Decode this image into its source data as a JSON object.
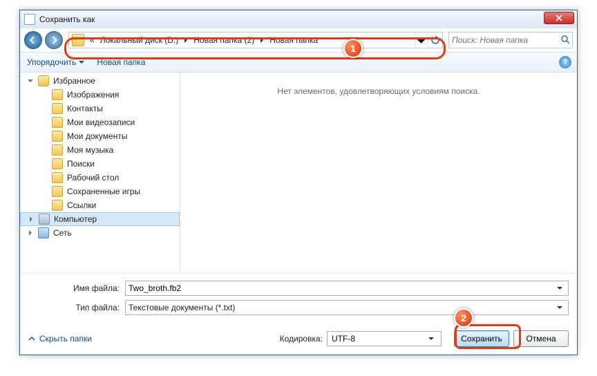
{
  "window": {
    "title": "Сохранить как"
  },
  "nav": {
    "breadcrumbs": [
      "Локальный диск (D:)",
      "Новая папка (2)",
      "Новая папка"
    ],
    "overflow": "«",
    "search_placeholder": "Поиск: Новая папка"
  },
  "toolbar": {
    "organize": "Упорядочить",
    "newfolder": "Новая папка"
  },
  "tree": {
    "items": [
      {
        "label": "Избранное",
        "kind": "star",
        "cat": true,
        "exp": "down"
      },
      {
        "label": "Изображения",
        "kind": "folder"
      },
      {
        "label": "Контакты",
        "kind": "folder"
      },
      {
        "label": "Мои видеозаписи",
        "kind": "folder"
      },
      {
        "label": "Мои документы",
        "kind": "folder"
      },
      {
        "label": "Моя музыка",
        "kind": "folder"
      },
      {
        "label": "Поиски",
        "kind": "folder"
      },
      {
        "label": "Рабочий стол",
        "kind": "folder"
      },
      {
        "label": "Сохраненные игры",
        "kind": "folder"
      },
      {
        "label": "Ссылки",
        "kind": "folder"
      },
      {
        "label": "Компьютер",
        "kind": "comp",
        "cat": true,
        "sel": true,
        "exp": "right"
      },
      {
        "label": "Сеть",
        "kind": "net",
        "cat": true,
        "exp": "right"
      }
    ]
  },
  "content": {
    "empty_msg": "Нет элементов, удовлетворяющих условиям поиска."
  },
  "fields": {
    "filename_label": "Имя файла:",
    "filename_value": "Two_broth.fb2",
    "filetype_label": "Тип файла:",
    "filetype_value": "Текстовые документы (*.txt)"
  },
  "bottom": {
    "hide_folders": "Скрыть папки",
    "encoding_label": "Кодировка:",
    "encoding_value": "UTF-8",
    "save": "Сохранить",
    "cancel": "Отмена"
  },
  "markers": {
    "m1": "1",
    "m2": "2"
  }
}
